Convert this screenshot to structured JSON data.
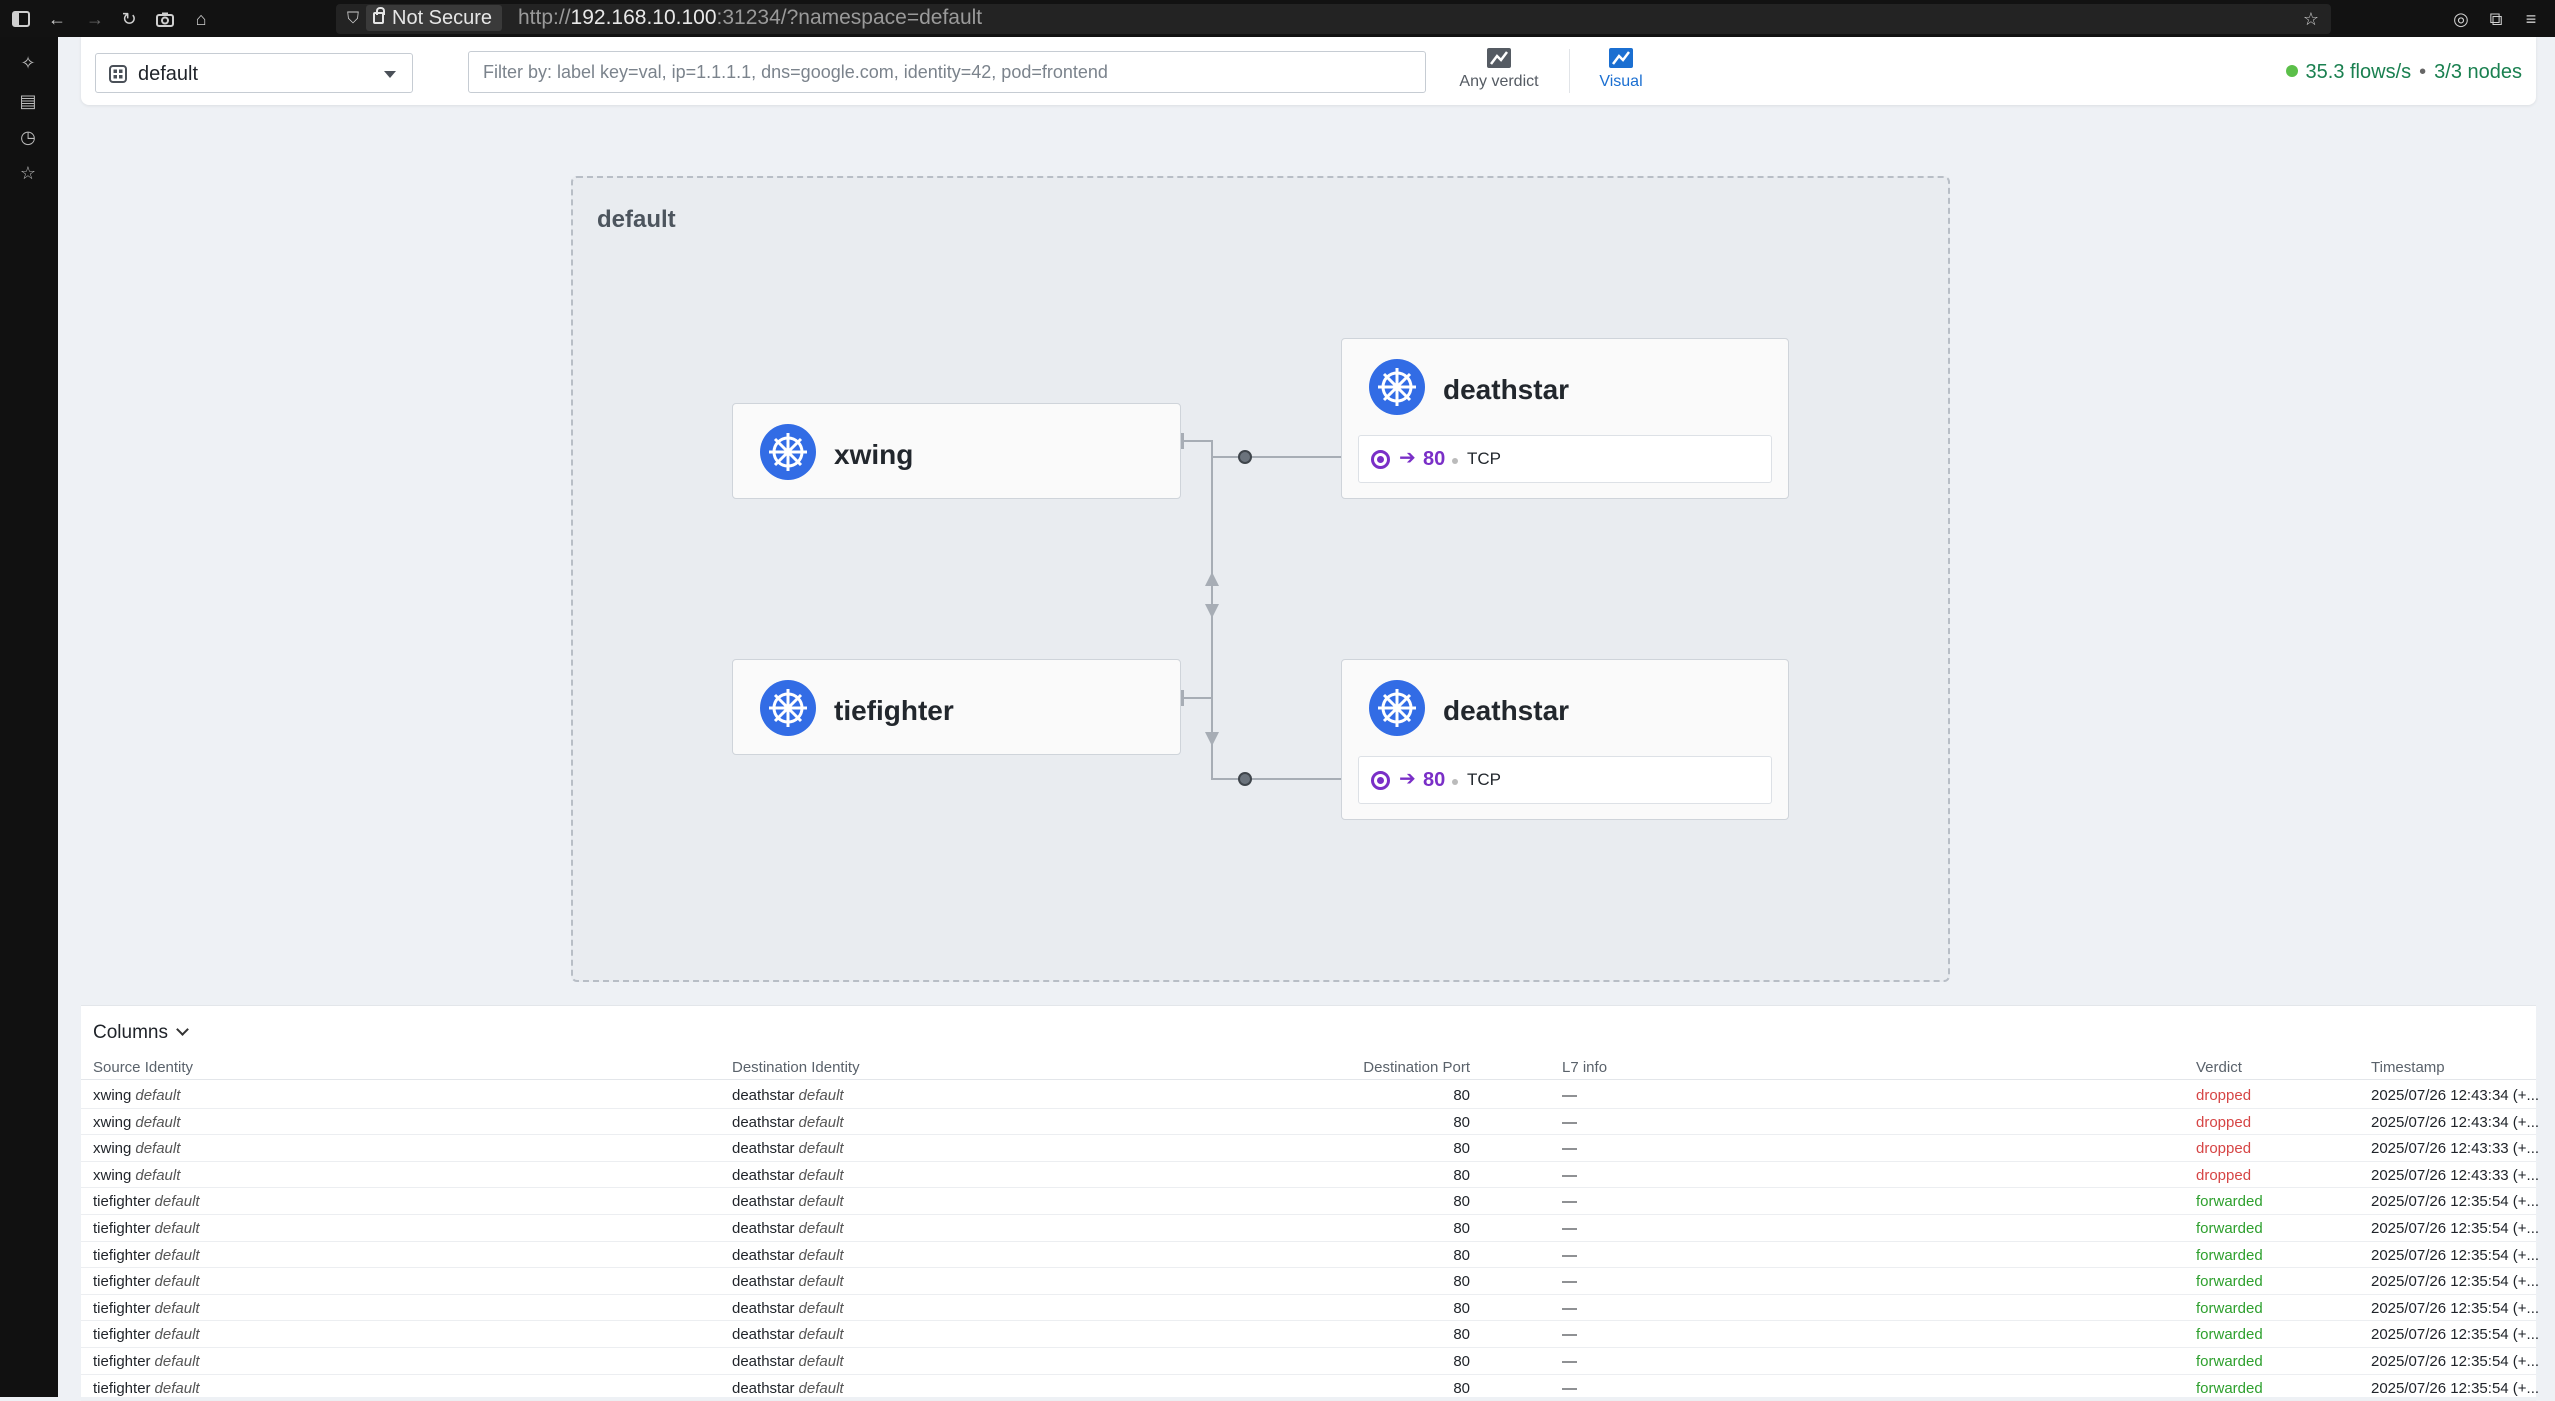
{
  "browser": {
    "not_secure": "Not Secure",
    "url_scheme": "http://",
    "url_host": "192.168.10.100",
    "url_rest": ":31234/?namespace=default"
  },
  "topbar": {
    "namespace": "default",
    "filter_placeholder": "Filter by: label key=val, ip=1.1.1.1, dns=google.com, identity=42, pod=frontend",
    "verdict_label": "Any verdict",
    "visual_label": "Visual",
    "flows_rate": "35.3 flows/s",
    "separator": "•",
    "nodes": "3/3 nodes"
  },
  "graph": {
    "namespace_title": "default",
    "nodes": [
      {
        "name": "xwing"
      },
      {
        "name": "tiefighter"
      },
      {
        "name": "deathstar",
        "port": "80",
        "protocol": "TCP"
      },
      {
        "name": "deathstar",
        "port": "80",
        "protocol": "TCP"
      }
    ]
  },
  "flows": {
    "columns_label": "Columns",
    "headers": {
      "source": "Source Identity",
      "destination": "Destination Identity",
      "port": "Destination Port",
      "l7": "L7 info",
      "verdict": "Verdict",
      "timestamp": "Timestamp"
    },
    "rows": [
      {
        "src": "xwing",
        "src_ns": "default",
        "dst": "deathstar",
        "dst_ns": "default",
        "port": "80",
        "l7": "—",
        "verdict": "dropped",
        "ts": "2025/07/26 12:43:34 (+..."
      },
      {
        "src": "xwing",
        "src_ns": "default",
        "dst": "deathstar",
        "dst_ns": "default",
        "port": "80",
        "l7": "—",
        "verdict": "dropped",
        "ts": "2025/07/26 12:43:34 (+..."
      },
      {
        "src": "xwing",
        "src_ns": "default",
        "dst": "deathstar",
        "dst_ns": "default",
        "port": "80",
        "l7": "—",
        "verdict": "dropped",
        "ts": "2025/07/26 12:43:33 (+..."
      },
      {
        "src": "xwing",
        "src_ns": "default",
        "dst": "deathstar",
        "dst_ns": "default",
        "port": "80",
        "l7": "—",
        "verdict": "dropped",
        "ts": "2025/07/26 12:43:33 (+..."
      },
      {
        "src": "tiefighter",
        "src_ns": "default",
        "dst": "deathstar",
        "dst_ns": "default",
        "port": "80",
        "l7": "—",
        "verdict": "forwarded",
        "ts": "2025/07/26 12:35:54 (+..."
      },
      {
        "src": "tiefighter",
        "src_ns": "default",
        "dst": "deathstar",
        "dst_ns": "default",
        "port": "80",
        "l7": "—",
        "verdict": "forwarded",
        "ts": "2025/07/26 12:35:54 (+..."
      },
      {
        "src": "tiefighter",
        "src_ns": "default",
        "dst": "deathstar",
        "dst_ns": "default",
        "port": "80",
        "l7": "—",
        "verdict": "forwarded",
        "ts": "2025/07/26 12:35:54 (+..."
      },
      {
        "src": "tiefighter",
        "src_ns": "default",
        "dst": "deathstar",
        "dst_ns": "default",
        "port": "80",
        "l7": "—",
        "verdict": "forwarded",
        "ts": "2025/07/26 12:35:54 (+..."
      },
      {
        "src": "tiefighter",
        "src_ns": "default",
        "dst": "deathstar",
        "dst_ns": "default",
        "port": "80",
        "l7": "—",
        "verdict": "forwarded",
        "ts": "2025/07/26 12:35:54 (+..."
      },
      {
        "src": "tiefighter",
        "src_ns": "default",
        "dst": "deathstar",
        "dst_ns": "default",
        "port": "80",
        "l7": "—",
        "verdict": "forwarded",
        "ts": "2025/07/26 12:35:54 (+..."
      },
      {
        "src": "tiefighter",
        "src_ns": "default",
        "dst": "deathstar",
        "dst_ns": "default",
        "port": "80",
        "l7": "—",
        "verdict": "forwarded",
        "ts": "2025/07/26 12:35:54 (+..."
      },
      {
        "src": "tiefighter",
        "src_ns": "default",
        "dst": "deathstar",
        "dst_ns": "default",
        "port": "80",
        "l7": "—",
        "verdict": "forwarded",
        "ts": "2025/07/26 12:35:54 (+..."
      }
    ]
  },
  "icons": {
    "kube": "kubernetes-helm-icon",
    "port": "endpoint-port-icon"
  },
  "colors": {
    "accent": "#1b6fd1",
    "kube_blue": "#326ce5",
    "port_purple": "#7a2fc7",
    "dropped": "#d64545",
    "forwarded": "#2ea02e",
    "status_green": "#5bbf49"
  }
}
